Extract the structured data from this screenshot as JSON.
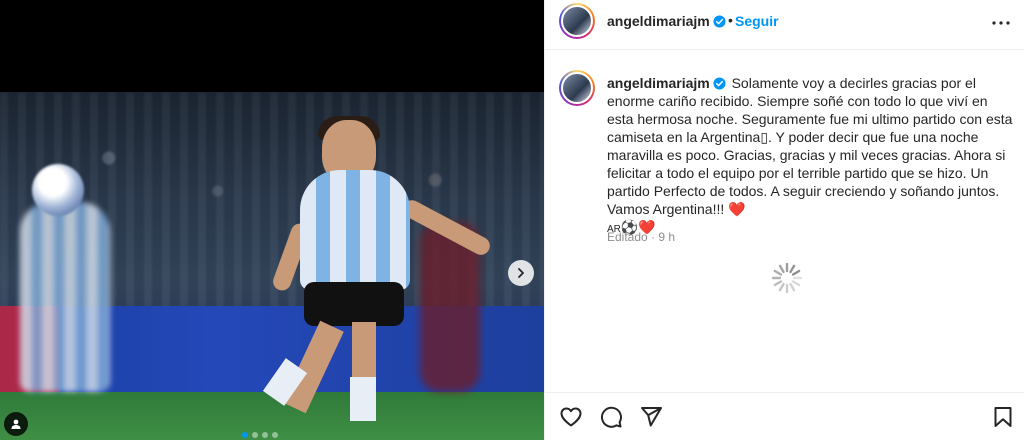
{
  "post": {
    "username": "angeldimariajm",
    "follow_label": "Seguir",
    "separator": "•",
    "caption": "Solamente voy a decirles gracias por el enorme cariño recibido. Siempre soñé con todo lo que viví en esta hermosa noche. Seguramente fue mi ultimo partido con esta camiseta en la Argentina▯. Y poder decir que fue una noche maravilla es poco. Gracias, gracias y mil veces gracias. Ahora si felicitar a todo el equipo por el terrible partido que se hizo. Un partido Perfecto de todos. A seguir creciendo y soñando juntos. Vamos Argentina!!!",
    "caption_emoji_heart": "❤️",
    "caption_flag": "AR",
    "caption_ball": "⚽",
    "edited_label": "Editado",
    "time_ago": "9 h"
  },
  "media": {
    "carousel_dots": 4,
    "active_dot": 0
  },
  "icons": {
    "more": "more-horizontal-icon",
    "next": "chevron-right-icon",
    "like": "heart-icon",
    "comment": "comment-icon",
    "share": "send-icon",
    "save": "bookmark-icon",
    "verified": "verified-badge-icon",
    "loading": "spinner-icon"
  },
  "colors": {
    "accent": "#0095f6",
    "heart": "#ed4956",
    "muted": "#8e8e8e"
  }
}
